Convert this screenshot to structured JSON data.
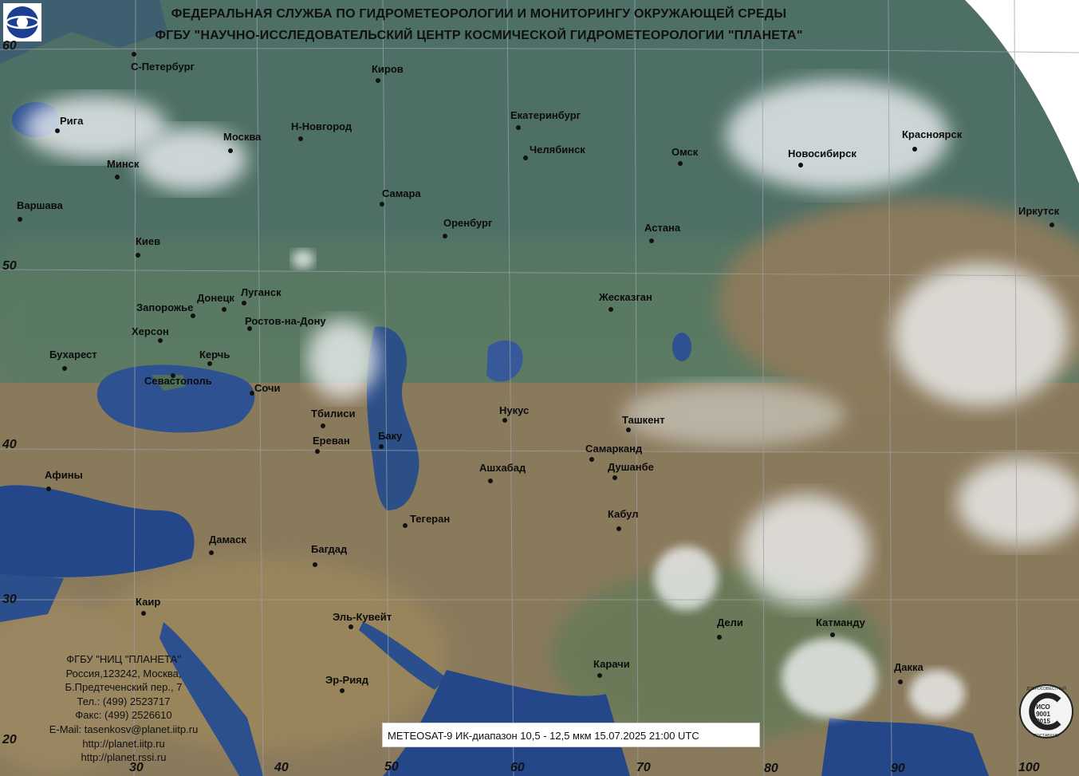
{
  "header": {
    "line1": "ФЕДЕРАЛЬНАЯ СЛУЖБА ПО ГИДРОМЕТЕОРОЛОГИИ И МОНИТОРИНГУ ОКРУЖАЮЩЕЙ СРЕДЫ",
    "line2": "ФГБУ \"НАУЧНО-ИССЛЕДОВАТЕЛЬСКИЙ ЦЕНТР КОСМИЧЕСКОЙ ГИДРОМЕТЕОРОЛОГИИ \"ПЛАНЕТА\""
  },
  "latitudes": [
    "60",
    "50",
    "40",
    "30",
    "20"
  ],
  "longitudes": [
    "30",
    "40",
    "50",
    "60",
    "70",
    "80",
    "90",
    "100"
  ],
  "cities": [
    "С-Петербург",
    "Киров",
    "Екатеринбург",
    "Рига",
    "Москва",
    "Н-Новгород",
    "Челябинск",
    "Омск",
    "Новосибирск",
    "Красноярск",
    "Минск",
    "Самара",
    "Варшава",
    "Оренбург",
    "Астана",
    "Иркутск",
    "Киев",
    "Запорожье",
    "Донецк",
    "Луганск",
    "Жесказган",
    "Херсон",
    "Ростов-на-Дону",
    "Бухарест",
    "Керчь",
    "Севастополь",
    "Сочи",
    "Тбилиси",
    "Нукус",
    "Ташкент",
    "Ереван",
    "Баку",
    "Самарканд",
    "Афины",
    "Ашхабад",
    "Душанбе",
    "Кабул",
    "Тегеран",
    "Дамаск",
    "Багдад",
    "Каир",
    "Эль-Кувейт",
    "Дели",
    "Катманду",
    "Карачи",
    "Дакка",
    "Эр-Рияд"
  ],
  "contact": {
    "org": "ФГБУ \"НИЦ \"ПЛАНЕТА\"",
    "address1": "Россия,123242, Москва,",
    "address2": "Б.Предтеченский пер., 7",
    "phone": "Тел.:  (499) 2523717",
    "fax": "Факс: (499) 2526610",
    "email": "E-Mail: tasenkosv@planet.iitp.ru",
    "url1": "http://planet.iitp.ru",
    "url2": "http://planet.rssi.ru"
  },
  "info": "METEOSAT-9   ИК-диапазон 10,5 - 12,5 мкм   15.07.2025  21:00 UTC",
  "iso_badge": {
    "top": "ДОБРОСОВЕСТНЫЙ",
    "mid": "ИСО",
    "num1": "9001",
    "num2": "2015",
    "bottom": "ПОСТАВЩИК"
  },
  "colors": {
    "sea": "#2c4f8e",
    "land_north": "#4f7262",
    "desert": "#8d7c5e",
    "grid": "#9aa0a8",
    "text": "#111111"
  }
}
